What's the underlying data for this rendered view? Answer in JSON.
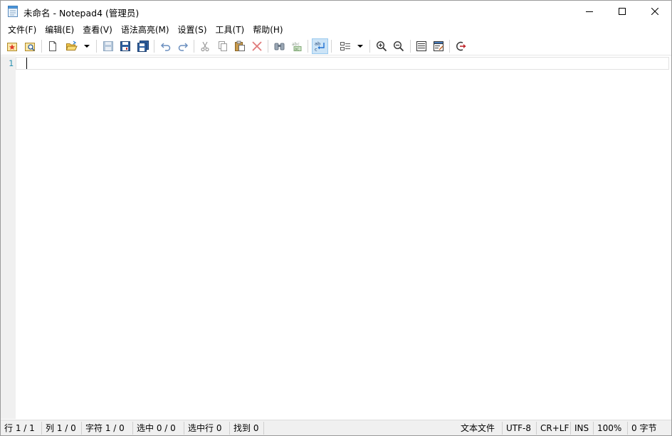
{
  "window": {
    "title": "未命名 - Notepad4 (管理员)"
  },
  "menu": [
    {
      "label": "文件(F)"
    },
    {
      "label": "编辑(E)"
    },
    {
      "label": "查看(V)"
    },
    {
      "label": "语法高亮(M)"
    },
    {
      "label": "设置(S)"
    },
    {
      "label": "工具(T)"
    },
    {
      "label": "帮助(H)"
    }
  ],
  "toolbar": {
    "icons": [
      "favorites-icon",
      "open-browse-icon",
      "new-file-icon",
      "open-folder-icon",
      "dropdown-arrow-icon",
      "save-icon",
      "save-as-icon",
      "save-all-icon",
      "undo-icon",
      "redo-icon",
      "cut-icon",
      "copy-icon",
      "paste-icon",
      "delete-icon",
      "find-icon",
      "replace-icon",
      "word-wrap-icon",
      "scheme-icon",
      "scheme-dropdown-icon",
      "zoom-in-icon",
      "zoom-out-icon",
      "view-list-icon",
      "edit-view-icon",
      "exit-icon"
    ]
  },
  "editor": {
    "line_numbers": [
      "1"
    ]
  },
  "statusbar": {
    "line": "行 1 / 1",
    "column": "列 1 / 0",
    "chars": "字符 1 / 0",
    "selection": "选中 0 / 0",
    "selected_lines": "选中行 0",
    "found": "找到 0",
    "file_type": "文本文件",
    "encoding": "UTF-8",
    "line_ending": "CR+LF",
    "insert_mode": "INS",
    "zoom": "100%",
    "size": "0 字节"
  },
  "colors": {
    "accent": "#0078d7",
    "line_number": "#2b91af",
    "gutter": "#f0f0f0",
    "statusbar": "#f0f0f0"
  }
}
